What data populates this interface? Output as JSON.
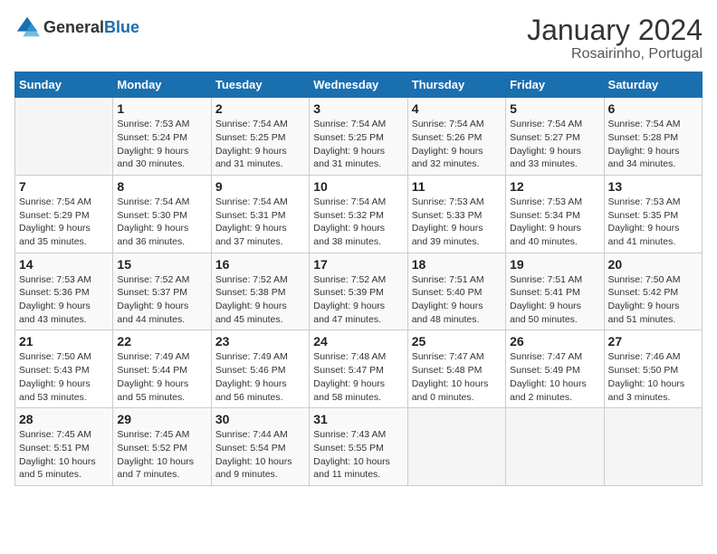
{
  "header": {
    "logo_general": "General",
    "logo_blue": "Blue",
    "title": "January 2024",
    "subtitle": "Rosairinho, Portugal"
  },
  "calendar": {
    "days_of_week": [
      "Sunday",
      "Monday",
      "Tuesday",
      "Wednesday",
      "Thursday",
      "Friday",
      "Saturday"
    ],
    "weeks": [
      [
        {
          "day": "",
          "info": ""
        },
        {
          "day": "1",
          "info": "Sunrise: 7:53 AM\nSunset: 5:24 PM\nDaylight: 9 hours\nand 30 minutes."
        },
        {
          "day": "2",
          "info": "Sunrise: 7:54 AM\nSunset: 5:25 PM\nDaylight: 9 hours\nand 31 minutes."
        },
        {
          "day": "3",
          "info": "Sunrise: 7:54 AM\nSunset: 5:25 PM\nDaylight: 9 hours\nand 31 minutes."
        },
        {
          "day": "4",
          "info": "Sunrise: 7:54 AM\nSunset: 5:26 PM\nDaylight: 9 hours\nand 32 minutes."
        },
        {
          "day": "5",
          "info": "Sunrise: 7:54 AM\nSunset: 5:27 PM\nDaylight: 9 hours\nand 33 minutes."
        },
        {
          "day": "6",
          "info": "Sunrise: 7:54 AM\nSunset: 5:28 PM\nDaylight: 9 hours\nand 34 minutes."
        }
      ],
      [
        {
          "day": "7",
          "info": "Sunrise: 7:54 AM\nSunset: 5:29 PM\nDaylight: 9 hours\nand 35 minutes."
        },
        {
          "day": "8",
          "info": "Sunrise: 7:54 AM\nSunset: 5:30 PM\nDaylight: 9 hours\nand 36 minutes."
        },
        {
          "day": "9",
          "info": "Sunrise: 7:54 AM\nSunset: 5:31 PM\nDaylight: 9 hours\nand 37 minutes."
        },
        {
          "day": "10",
          "info": "Sunrise: 7:54 AM\nSunset: 5:32 PM\nDaylight: 9 hours\nand 38 minutes."
        },
        {
          "day": "11",
          "info": "Sunrise: 7:53 AM\nSunset: 5:33 PM\nDaylight: 9 hours\nand 39 minutes."
        },
        {
          "day": "12",
          "info": "Sunrise: 7:53 AM\nSunset: 5:34 PM\nDaylight: 9 hours\nand 40 minutes."
        },
        {
          "day": "13",
          "info": "Sunrise: 7:53 AM\nSunset: 5:35 PM\nDaylight: 9 hours\nand 41 minutes."
        }
      ],
      [
        {
          "day": "14",
          "info": "Sunrise: 7:53 AM\nSunset: 5:36 PM\nDaylight: 9 hours\nand 43 minutes."
        },
        {
          "day": "15",
          "info": "Sunrise: 7:52 AM\nSunset: 5:37 PM\nDaylight: 9 hours\nand 44 minutes."
        },
        {
          "day": "16",
          "info": "Sunrise: 7:52 AM\nSunset: 5:38 PM\nDaylight: 9 hours\nand 45 minutes."
        },
        {
          "day": "17",
          "info": "Sunrise: 7:52 AM\nSunset: 5:39 PM\nDaylight: 9 hours\nand 47 minutes."
        },
        {
          "day": "18",
          "info": "Sunrise: 7:51 AM\nSunset: 5:40 PM\nDaylight: 9 hours\nand 48 minutes."
        },
        {
          "day": "19",
          "info": "Sunrise: 7:51 AM\nSunset: 5:41 PM\nDaylight: 9 hours\nand 50 minutes."
        },
        {
          "day": "20",
          "info": "Sunrise: 7:50 AM\nSunset: 5:42 PM\nDaylight: 9 hours\nand 51 minutes."
        }
      ],
      [
        {
          "day": "21",
          "info": "Sunrise: 7:50 AM\nSunset: 5:43 PM\nDaylight: 9 hours\nand 53 minutes."
        },
        {
          "day": "22",
          "info": "Sunrise: 7:49 AM\nSunset: 5:44 PM\nDaylight: 9 hours\nand 55 minutes."
        },
        {
          "day": "23",
          "info": "Sunrise: 7:49 AM\nSunset: 5:46 PM\nDaylight: 9 hours\nand 56 minutes."
        },
        {
          "day": "24",
          "info": "Sunrise: 7:48 AM\nSunset: 5:47 PM\nDaylight: 9 hours\nand 58 minutes."
        },
        {
          "day": "25",
          "info": "Sunrise: 7:47 AM\nSunset: 5:48 PM\nDaylight: 10 hours\nand 0 minutes."
        },
        {
          "day": "26",
          "info": "Sunrise: 7:47 AM\nSunset: 5:49 PM\nDaylight: 10 hours\nand 2 minutes."
        },
        {
          "day": "27",
          "info": "Sunrise: 7:46 AM\nSunset: 5:50 PM\nDaylight: 10 hours\nand 3 minutes."
        }
      ],
      [
        {
          "day": "28",
          "info": "Sunrise: 7:45 AM\nSunset: 5:51 PM\nDaylight: 10 hours\nand 5 minutes."
        },
        {
          "day": "29",
          "info": "Sunrise: 7:45 AM\nSunset: 5:52 PM\nDaylight: 10 hours\nand 7 minutes."
        },
        {
          "day": "30",
          "info": "Sunrise: 7:44 AM\nSunset: 5:54 PM\nDaylight: 10 hours\nand 9 minutes."
        },
        {
          "day": "31",
          "info": "Sunrise: 7:43 AM\nSunset: 5:55 PM\nDaylight: 10 hours\nand 11 minutes."
        },
        {
          "day": "",
          "info": ""
        },
        {
          "day": "",
          "info": ""
        },
        {
          "day": "",
          "info": ""
        }
      ]
    ]
  }
}
